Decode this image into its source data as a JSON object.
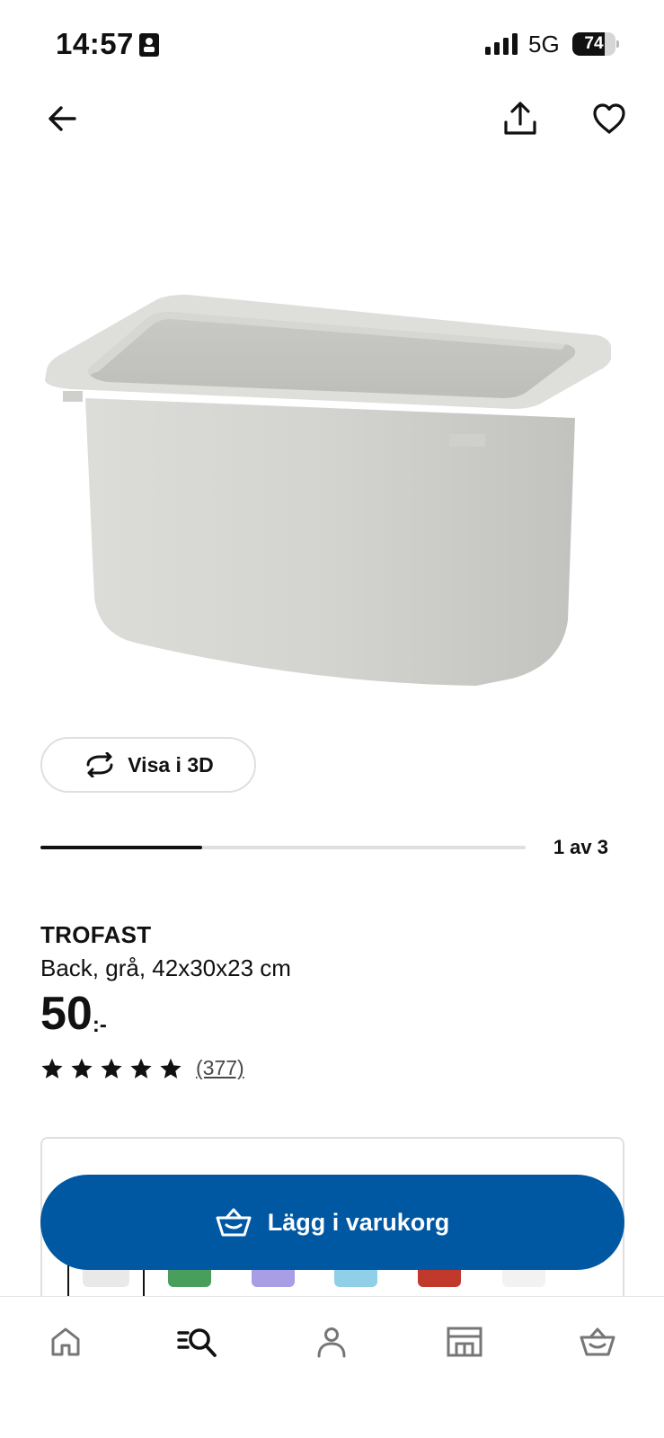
{
  "status_bar": {
    "time": "14:57",
    "network": "5G",
    "battery_percent": 74,
    "battery_label": "74"
  },
  "header": {
    "back_icon": "arrow-left-icon",
    "share_icon": "share-icon",
    "favorite_icon": "heart-icon"
  },
  "gallery": {
    "view_3d_label": "Visa i 3D",
    "view_3d_icon": "rotate-3d-icon",
    "counter_label": "1 av 3",
    "current_image": 1,
    "total_images": 3,
    "progress_fraction": 0.333
  },
  "product": {
    "name": "TROFAST",
    "description": "Back, grå, 42x30x23 cm",
    "price": "50",
    "price_suffix": ":-",
    "rating_stars": 5,
    "review_count": "(377)"
  },
  "variants": {
    "swatch_colors": [
      "#e9e9e9",
      "#4a9e5c",
      "#a89ee6",
      "#8fcfe8",
      "#c0392b",
      "#f2f2f2"
    ]
  },
  "cart": {
    "label": "Lägg i varukorg",
    "icon": "basket-icon",
    "color": "#0058a3"
  },
  "bottom_nav": {
    "tabs": [
      {
        "name": "home",
        "icon": "home-icon",
        "active": false
      },
      {
        "name": "search",
        "icon": "search-list-icon",
        "active": true
      },
      {
        "name": "profile",
        "icon": "person-icon",
        "active": false
      },
      {
        "name": "store",
        "icon": "store-icon",
        "active": false
      },
      {
        "name": "cart",
        "icon": "basket-icon",
        "active": false
      }
    ]
  }
}
